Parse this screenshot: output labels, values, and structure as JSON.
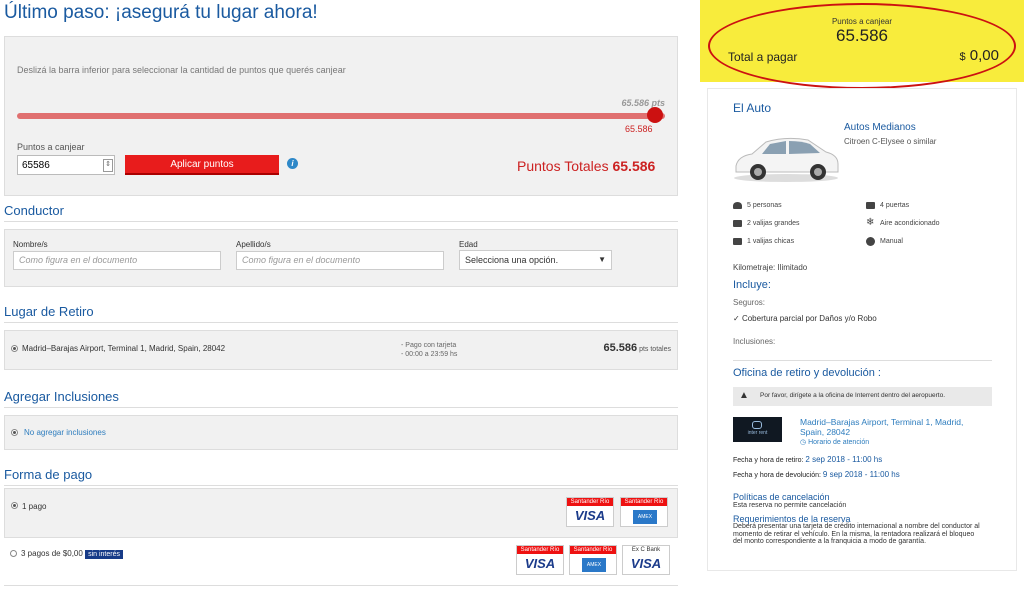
{
  "page_title": "Último paso: ¡asegurá tu lugar ahora!",
  "redeem": {
    "hint": "Deslizá la barra inferior para seleccionar la cantidad de puntos que querés canjear",
    "max_points": "65.586",
    "max_unit": "pts",
    "knob_value": "65.586",
    "slider_fraction": 1.0,
    "points_label": "Puntos a canjear",
    "points_value": "65586",
    "apply_label": "Aplicar puntos",
    "total_label": "Puntos Totales",
    "total_value": "65.586"
  },
  "driver": {
    "title": "Conductor",
    "name_label": "Nombre/s",
    "name_placeholder": "Como figura en el documento",
    "surname_label": "Apellido/s",
    "surname_placeholder": "Como figura en el documento",
    "age_label": "Edad",
    "age_value": "Selecciona una opción."
  },
  "pickup": {
    "title": "Lugar de Retiro",
    "location": "Madrid–Barajas Airport, Terminal 1, Madrid, Spain, 28042",
    "payment_note": "- Pago con tarjeta",
    "hours_note": "- 00:00 a 23:59 hs",
    "points": "65.586",
    "points_unit": "pts totales"
  },
  "inclusions": {
    "title": "Agregar Inclusiones",
    "option": "No agregar inclusiones"
  },
  "payment": {
    "title": "Forma de pago",
    "option1": "1 pago",
    "option2": "3 pagos de $0,00",
    "badge": "sin interés",
    "bank_santander": "Santander Río",
    "bank_exc": "Ex C Bank",
    "visa": "VISA",
    "amex": "AMEX"
  },
  "summary": {
    "points_label": "Puntos a canjear",
    "points_value": "65.586",
    "total_label": "Total a pagar",
    "total_currency": "$",
    "total_value": "0,00"
  },
  "car": {
    "section_title": "El Auto",
    "category": "Autos Medianos",
    "model": "Citroen C-Elysee o similar",
    "features": {
      "persons": "5 personas",
      "doors": "4 puertas",
      "large_bags": "2 valijas grandes",
      "ac": "Aire acondicionado",
      "small_bags": "1 valijas chicas",
      "transmission": "Manual"
    },
    "mileage": "Kilometraje: Ilimitado",
    "includes_title": "Incluye:",
    "insurance_label": "Seguros:",
    "insurance_item": "Cobertura parcial por Daños y/o Robo",
    "inclusions_label": "Inclusiones:"
  },
  "office": {
    "title": "Oficina de retiro y devolución :",
    "warning": "Por favor, dirígete a la oficina de Interrent dentro del aeropuerto.",
    "logo_text": "inter rent",
    "address": "Madrid–Barajas Airport, Terminal 1, Madrid, Spain, 28042",
    "hours_link": "Horario de atención",
    "pickup_label": "Fecha y hora de retiro:",
    "pickup_value": "2 sep 2018 - 11:00 hs",
    "return_label": "Fecha y hora de devolución:",
    "return_value": "9 sep 2018 - 11:00 hs"
  },
  "policies": {
    "cancel_title": "Políticas de cancelación",
    "cancel_text": "Esta reserva no permite cancelación",
    "req_title": "Requerimientos de la reserva",
    "req_text": "Deberá presentar una tarjeta de crédito internacional a nombre del conductor al momento de retirar el vehículo. En la misma, la rentadora realizará el bloqueo del monto correspondiente a la franquicia a modo de garantía."
  },
  "colors": {
    "brand_blue": "#1a5aa0",
    "red": "#e81c1c",
    "yellow": "#f8ec3c"
  }
}
